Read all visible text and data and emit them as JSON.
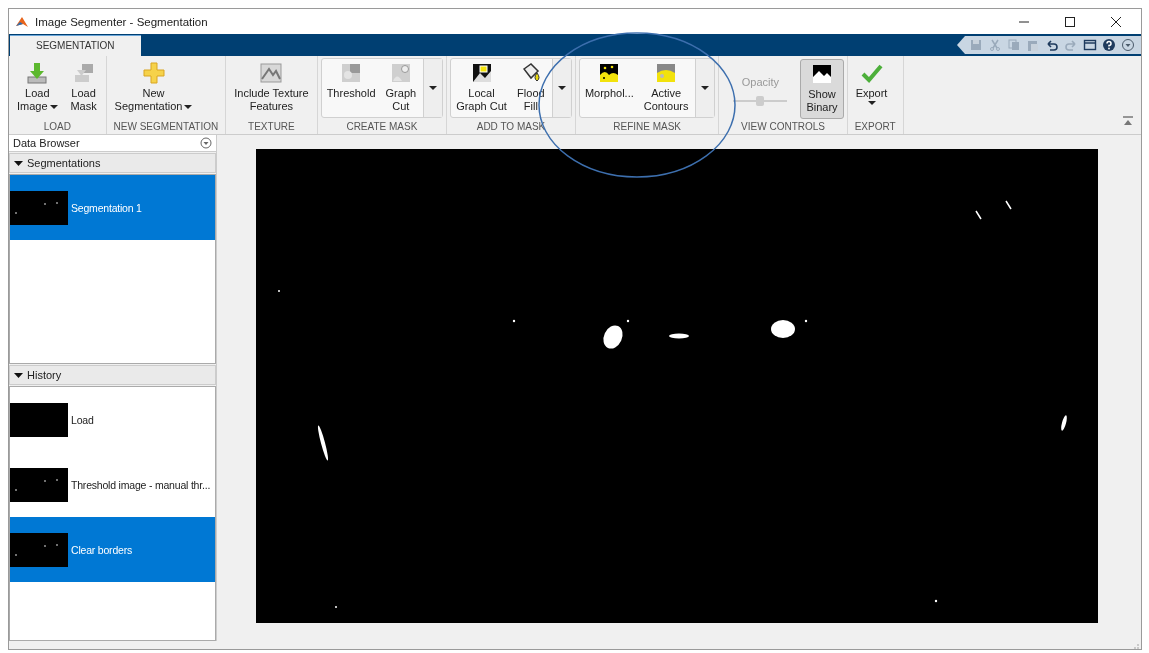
{
  "window": {
    "title": "Image Segmenter - Segmentation"
  },
  "tabs": [
    {
      "label": "SEGMENTATION",
      "selected": true
    }
  ],
  "toolstrip": [
    {
      "title": "LOAD",
      "kind": "plain",
      "buttons": [
        {
          "lines": [
            "Load",
            "Image"
          ],
          "dropdown": true
        },
        {
          "lines": [
            "Load",
            "Mask"
          ],
          "dropdown": false
        }
      ]
    },
    {
      "title": "NEW SEGMENTATION",
      "kind": "plain",
      "buttons": [
        {
          "lines": [
            "New",
            "Segmentation"
          ],
          "dropdown": true
        }
      ]
    },
    {
      "title": "TEXTURE",
      "kind": "plain",
      "buttons": [
        {
          "lines": [
            "Include Texture",
            "Features"
          ],
          "dropdown": false
        }
      ]
    },
    {
      "title": "CREATE MASK",
      "kind": "gallery",
      "buttons": [
        {
          "lines": [
            "Threshold"
          ],
          "dropdown": false
        },
        {
          "lines": [
            "Graph",
            "Cut"
          ],
          "dropdown": false
        }
      ]
    },
    {
      "title": "ADD TO MASK",
      "kind": "gallery",
      "buttons": [
        {
          "lines": [
            "Local",
            "Graph Cut"
          ],
          "dropdown": false
        },
        {
          "lines": [
            "Flood",
            "Fill"
          ],
          "dropdown": false
        }
      ]
    },
    {
      "title": "REFINE MASK",
      "kind": "gallery",
      "buttons": [
        {
          "lines": [
            "Morphol..."
          ],
          "dropdown": false
        },
        {
          "lines": [
            "Active",
            "Contours"
          ],
          "dropdown": false
        }
      ]
    },
    {
      "title": "VIEW CONTROLS",
      "kind": "view",
      "opacity": {
        "label": "Opacity",
        "disabled": true,
        "level": 0.5
      },
      "buttons": [
        {
          "lines": [
            "Show",
            "Binary"
          ],
          "dropdown": false,
          "selected": true
        }
      ]
    },
    {
      "title": "EXPORT",
      "kind": "plain",
      "buttons": [
        {
          "lines": [
            "Export"
          ],
          "dropdown": true
        }
      ]
    }
  ],
  "data_browser": {
    "title": "Data Browser",
    "sections": [
      {
        "title": "Segmentations",
        "expanded": true,
        "items": [
          {
            "label": "Segmentation 1",
            "selected": true,
            "kind": "picture"
          }
        ]
      },
      {
        "title": "History",
        "expanded": true,
        "items": [
          {
            "label": "Load",
            "selected": false,
            "kind": "picture"
          },
          {
            "label": "Threshold image - manual thr...",
            "selected": false,
            "kind": "picture"
          },
          {
            "label": "Clear borders",
            "selected": true,
            "kind": "picture"
          }
        ]
      }
    ]
  },
  "annotation_circle": true
}
